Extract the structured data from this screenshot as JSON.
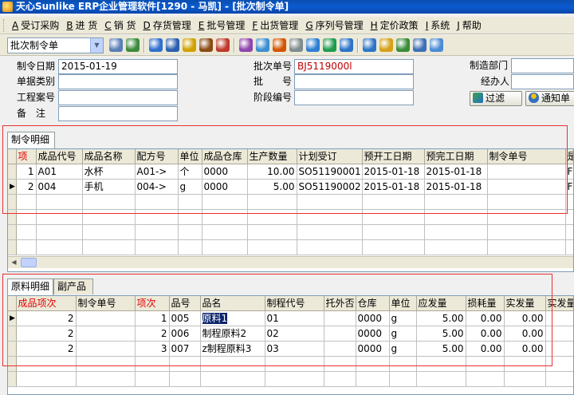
{
  "window": {
    "title": "天心Sunlike ERP企业管理软件[1290 - 马凯] - [批次制令单]"
  },
  "menu": [
    {
      "key": "A",
      "label": "受订采购"
    },
    {
      "key": "B",
      "label": "进 货"
    },
    {
      "key": "C",
      "label": "销 货"
    },
    {
      "key": "D",
      "label": "存货管理"
    },
    {
      "key": "E",
      "label": "批号管理"
    },
    {
      "key": "F",
      "label": "出货管理"
    },
    {
      "key": "G",
      "label": "序列号管理"
    },
    {
      "key": "H",
      "label": "定价政策"
    },
    {
      "key": "I",
      "label": "系统"
    },
    {
      "key": "J",
      "label": "帮助"
    }
  ],
  "toolbar": {
    "doc_type": "批次制令单",
    "icons": [
      "cut-icon",
      "calculator-icon",
      "globe-icon",
      "phone-icon",
      "lock-icon",
      "briefcase-icon",
      "home-icon",
      "people-icon",
      "mail-icon",
      "gift-icon",
      "key-icon",
      "help-icon",
      "money-icon",
      "cart-icon",
      "check-icon",
      "tools-icon",
      "tree-icon",
      "monitor-icon",
      "window-icon"
    ],
    "icon_colors": [
      "#5a7fb8",
      "#3c8a3c",
      "#2f6fcf",
      "#2a5fb0",
      "#d1a000",
      "#8a4b14",
      "#c0392b",
      "#8e44ad",
      "#3b8fd1",
      "#d35400",
      "#7f8c8d",
      "#2d7fd3",
      "#1e9b4e",
      "#2d74c8",
      "#2d74c8",
      "#d4a017",
      "#3a8c3a",
      "#3d6fb6",
      "#4b8bd6"
    ]
  },
  "header": {
    "order_date_label": "制令日期",
    "order_date": "2015-01-19",
    "doc_category_label": "单据类别",
    "doc_category": "",
    "project_no_label": "工程案号",
    "project_no": "",
    "remark_label": "备　注",
    "remark": "",
    "batch_no_label": "批次单号",
    "batch_no": "BJ5119000l",
    "batch_label": "批　　号",
    "batch": "",
    "stage_no_label": "阶段编号",
    "stage_no": "",
    "mfg_dept_label": "制造部门",
    "mfg_dept": "",
    "handler_label": "经办人",
    "handler": "",
    "filter_button": "过滤",
    "notify_button": "通知单"
  },
  "orders_tab": {
    "tabs": [
      "制令明细"
    ]
  },
  "orders": {
    "columns": [
      "项",
      "成品代号",
      "成品名称",
      "配方号",
      "单位",
      "成品仓库",
      "生产数量",
      "计划受订",
      "预开工日期",
      "预完工日期",
      "制令单号",
      "是"
    ],
    "rows": [
      [
        "1",
        "A01",
        "水杯",
        "A01->",
        "个",
        "0000",
        "10.00",
        "SO51190001",
        "2015-01-18",
        "2015-01-18",
        "",
        "F"
      ],
      [
        "2",
        "004",
        "手机",
        "004->",
        "g",
        "0000",
        "5.00",
        "SO51190002",
        "2015-01-18",
        "2015-01-18",
        "",
        "F"
      ]
    ]
  },
  "materials_tabs": {
    "tabs": [
      "原料明细",
      "副产品"
    ]
  },
  "materials": {
    "columns": [
      "成品项次",
      "制令单号",
      "项次",
      "品号",
      "品名",
      "制程代号",
      "托外否",
      "仓库",
      "单位",
      "应发量",
      "损耗量",
      "实发量",
      "实发量(未"
    ],
    "rows": [
      [
        "2",
        "",
        "1",
        "005",
        "原料1",
        "01",
        "",
        "0000",
        "g",
        "5.00",
        "0.00",
        "0.00",
        ""
      ],
      [
        "2",
        "",
        "2",
        "006",
        "制程原料2",
        "02",
        "",
        "0000",
        "g",
        "5.00",
        "0.00",
        "0.00",
        ""
      ],
      [
        "2",
        "",
        "3",
        "007",
        "z制程原料3",
        "03",
        "",
        "0000",
        "g",
        "5.00",
        "0.00",
        "0.00",
        ""
      ]
    ]
  }
}
